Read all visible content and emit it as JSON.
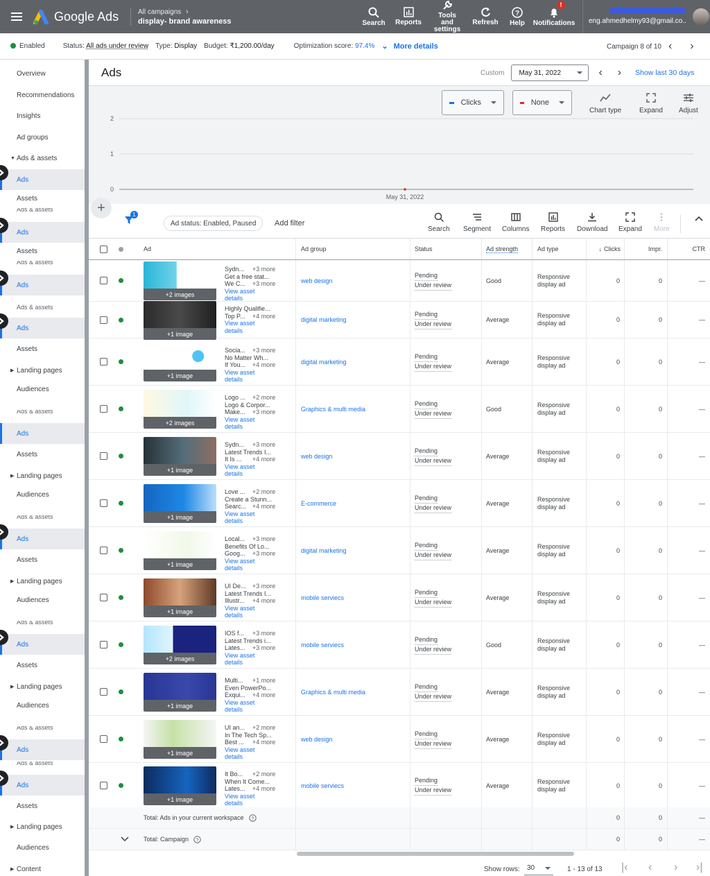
{
  "header": {
    "app_name": "Google Ads",
    "breadcrumb_top": "All campaigns",
    "breadcrumb_main": "display- brand awareness",
    "actions": [
      {
        "label": "Search",
        "icon": "search-icon"
      },
      {
        "label": "Reports",
        "icon": "reports-icon"
      },
      {
        "label": "Tools and settings",
        "icon": "wrench-icon"
      },
      {
        "label": "Refresh",
        "icon": "refresh-icon"
      },
      {
        "label": "Help",
        "icon": "help-icon"
      },
      {
        "label": "Notifications",
        "icon": "bell-icon",
        "badge": "!"
      }
    ],
    "account_email": "eng.ahmedhelmy93@gmail.co..."
  },
  "statusbar": {
    "enabled": "Enabled",
    "status_label": "Status:",
    "status_value": "All ads under review",
    "type_label": "Type:",
    "type_value": "Display",
    "budget_label": "Budget:",
    "budget_value": "₹1,200.00/day",
    "opt_label": "Optimization score:",
    "opt_value": "97.4%",
    "more_details": "More details",
    "campaign_counter": "Campaign 8 of 10"
  },
  "sidebar": {
    "overview": "Overview",
    "recommendations": "Recommendations",
    "insights": "Insights",
    "ad_groups": "Ad groups",
    "ads_assets": "Ads & assets",
    "ads": "Ads",
    "assets": "Assets",
    "landing_pages": "Landing pages",
    "audiences": "Audiences",
    "content": "Content"
  },
  "page": {
    "title": "Ads",
    "custom": "Custom",
    "date": "May 31, 2022",
    "show_last": "Show last 30 days"
  },
  "chart": {
    "metric1": "Clicks",
    "metric2": "None",
    "chart_type": "Chart type",
    "expand": "Expand",
    "adjust": "Adjust",
    "y_ticks": [
      "2",
      "1",
      "0"
    ],
    "x_label": "May 31, 2022"
  },
  "chart_data": {
    "type": "line",
    "x": [
      "May 31, 2022"
    ],
    "series": [
      {
        "name": "Clicks",
        "values": [
          0
        ]
      }
    ],
    "ylim": [
      0,
      2
    ],
    "grid": true
  },
  "filterbar": {
    "filter_badge": "1",
    "chip": "Ad status: Enabled, Paused",
    "add_filter": "Add filter",
    "tools": [
      "Search",
      "Segment",
      "Columns",
      "Reports",
      "Download",
      "Expand",
      "More"
    ]
  },
  "table": {
    "columns": {
      "ad": "Ad",
      "ad_group": "Ad group",
      "status": "Status",
      "ad_strength": "Ad strength",
      "ad_type": "Ad type",
      "clicks": "Clicks",
      "impr": "Impr.",
      "ctr": "CTR"
    },
    "rows": [
      {
        "img": "+2 images",
        "l1": "Sydn...",
        "m1": "+3 more",
        "l2": "Get a free stat...",
        "l3": "We C...",
        "m3": "+3 more",
        "group": "web design",
        "strength": "Good",
        "theme": "web"
      },
      {
        "img": "+1 image",
        "l1": "Highly Qualifie...",
        "m1": "",
        "l2": "Top P...",
        "m2": "+4 more",
        "l3": "",
        "group": "digital marketing",
        "strength": "Average",
        "theme": "dark"
      },
      {
        "img": "+1 image",
        "l1": "Socia...",
        "m1": "+3 more",
        "l2": "No Matter Wh...",
        "l3": "If You...",
        "m3": "+4 more",
        "group": "digital marketing",
        "strength": "Average",
        "theme": "social"
      },
      {
        "img": "+2 images",
        "l1": "Logo ...",
        "m1": "+2 more",
        "l2": "Logo & Corpor...",
        "l3": "Make...",
        "m3": "+3 more",
        "group": "Graphics & multi media",
        "strength": "Good",
        "theme": "logo"
      },
      {
        "img": "+1 image",
        "l1": "Sydn...",
        "m1": "+3 more",
        "l2": "Latest Trends I...",
        "l3": "It Is ...",
        "m3": "+4 more",
        "group": "web design",
        "strength": "Average",
        "theme": "code"
      },
      {
        "img": "+1 image",
        "l1": "Love ...",
        "m1": "+2 more",
        "l2": "Create a Stunn...",
        "l3": "Searc...",
        "m3": "+4 more",
        "group": "E-commerce",
        "strength": "Average",
        "theme": "wp"
      },
      {
        "img": "+1 image",
        "l1": "Local...",
        "m1": "+3 more",
        "l2": "Benefits Of Lo...",
        "l3": "Goog...",
        "m3": "+3 more",
        "group": "digital marketing",
        "strength": "Average",
        "theme": "local"
      },
      {
        "img": "+1 image",
        "l1": "UI De...",
        "m1": "+3 more",
        "l2": "Latest Trends I...",
        "l3": "Illustr...",
        "m3": "+4 more",
        "group": "mobile serviecs",
        "strength": "Average",
        "theme": "ui"
      },
      {
        "img": "+2 images",
        "l1": "IOS f...",
        "m1": "+3 more",
        "l2": "Latest Trends i...",
        "l3": "Lates...",
        "m3": "+3 more",
        "group": "mobile serviecs",
        "strength": "Good",
        "theme": "ios"
      },
      {
        "img": "+1 image",
        "l1": "Multi...",
        "m1": "+1 more",
        "l2": "Even PowerPo...",
        "l3": "Exqui...",
        "m3": "+4 more",
        "group": "Graphics & multi media",
        "strength": "Average",
        "theme": "multi"
      },
      {
        "img": "+1 image",
        "l1": "UI an...",
        "m1": "+2 more",
        "l2": "In The Tech Sp...",
        "l3": "Best ...",
        "m3": "+4 more",
        "group": "web design",
        "strength": "Average",
        "theme": "hand"
      },
      {
        "img": "+1 image",
        "l1": "It Bo...",
        "m1": "+2 more",
        "l2": "When It Come...",
        "l3": "Lates...",
        "m3": "+4 more",
        "group": "mobile serviecs",
        "strength": "Average",
        "theme": "android"
      }
    ],
    "view_asset": "View asset",
    "details": "details",
    "status_l1": "Pending",
    "status_l2": "Under review",
    "type_l1": "Responsive",
    "type_l2": "display ad",
    "zero": "0",
    "dash": "—",
    "total_workspace": "Total: Ads in your current workspace",
    "total_campaign": "Total: Campaign"
  },
  "footer": {
    "show_rows": "Show rows:",
    "rows_value": "30",
    "range": "1 - 13 of 13"
  },
  "colors": {
    "accent": "#1a73e8",
    "green": "#1e8e3e",
    "header_bg": "#5f6368"
  }
}
